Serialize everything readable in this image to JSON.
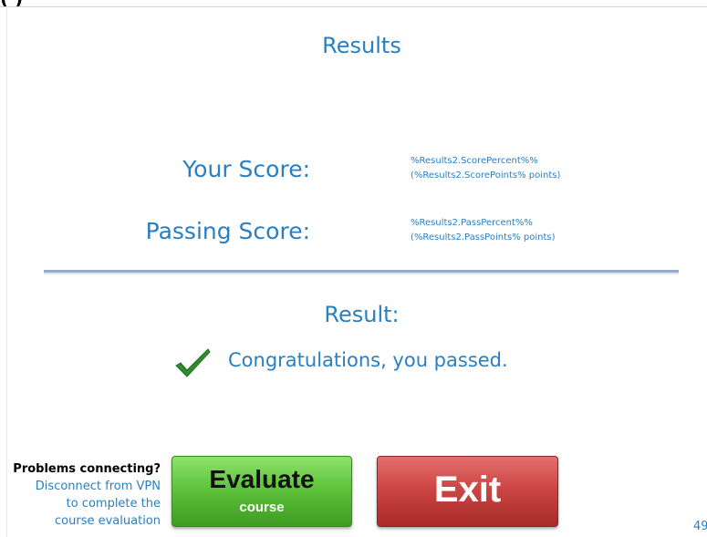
{
  "header": {
    "cut_text": "(         )"
  },
  "results": {
    "title": "Results",
    "your_score_label": "Your Score:",
    "your_score_line1": "%Results2.ScorePercent%%",
    "your_score_line2": "(%Results2.ScorePoints% points)",
    "passing_score_label": "Passing Score:",
    "passing_score_line1": "%Results2.PassPercent%%",
    "passing_score_line2": "(%Results2.PassPoints% points)",
    "result_label": "Result:",
    "result_message": "Congratulations, you passed.",
    "check_icon": "checkmark-icon"
  },
  "help": {
    "heading": "Problems connecting?",
    "line1": "Disconnect from VPN",
    "line2": "to complete the",
    "line3": "course evaluation"
  },
  "buttons": {
    "evaluate_main": "Evaluate",
    "evaluate_sub": "course",
    "exit": "Exit"
  },
  "page": {
    "number": "49"
  },
  "colors": {
    "text_blue": "#2a7fc0",
    "evaluate_green": "#5fc33c",
    "exit_red": "#cc4644",
    "check_green": "#2e8b2e"
  }
}
